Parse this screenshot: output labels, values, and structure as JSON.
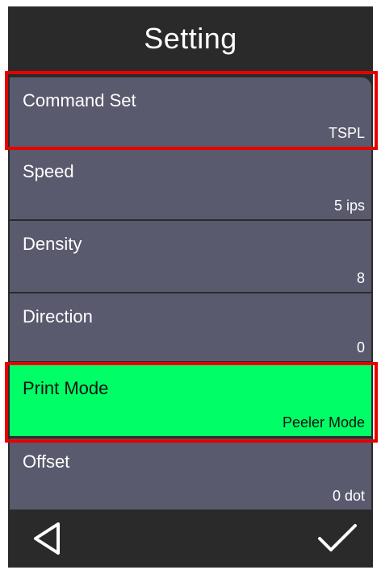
{
  "screen": {
    "title": "Setting"
  },
  "settings": [
    {
      "label": "Command Set",
      "value": "TSPL"
    },
    {
      "label": "Speed",
      "value": "5 ips"
    },
    {
      "label": "Density",
      "value": "8"
    },
    {
      "label": "Direction",
      "value": "0"
    },
    {
      "label": "Print Mode",
      "value": "Peeler Mode"
    },
    {
      "label": "Offset",
      "value": "0 dot"
    }
  ],
  "nav": {
    "back_icon": "back-triangle-icon",
    "confirm_icon": "checkmark-icon"
  },
  "colors": {
    "background": "#2a2a2a",
    "row": "#5a5a6e",
    "selected_row": "#00ff66",
    "highlight_border": "#e60000",
    "text": "#ffffff"
  }
}
